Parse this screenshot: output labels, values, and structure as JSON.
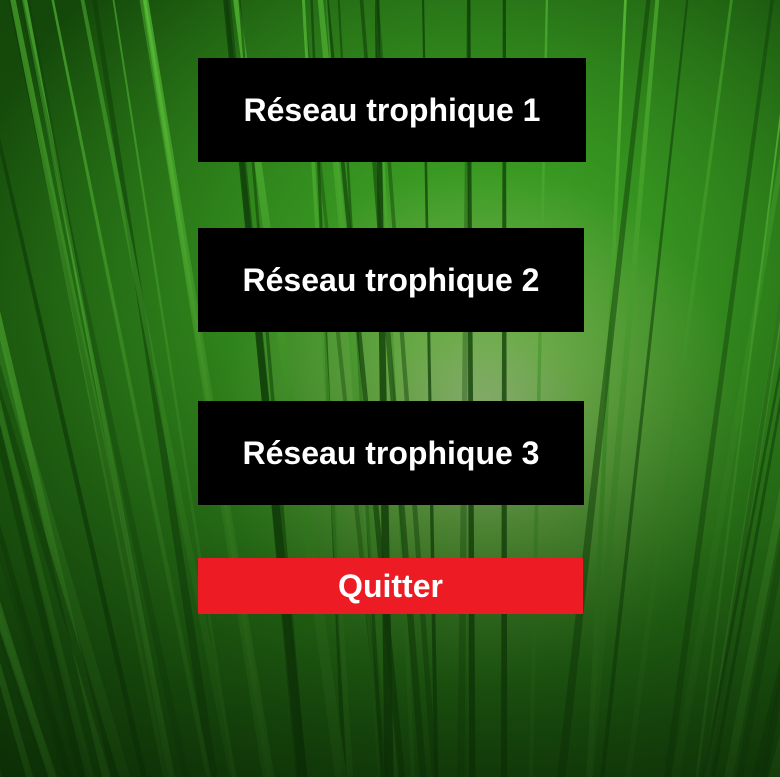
{
  "background": {
    "description_icon": "bamboo-forest-image",
    "canopy_color": "#2fa81e",
    "light_color": "#d9f7a8",
    "trunk_dark": "#0f3d08",
    "trunk_light": "#5cc43a"
  },
  "menu": {
    "buttons": [
      {
        "label": "Réseau trophique 1"
      },
      {
        "label": "Réseau trophique 2"
      },
      {
        "label": "Réseau trophique 3"
      }
    ],
    "quit": {
      "label": "Quitter",
      "color": "#ed1c24"
    }
  }
}
